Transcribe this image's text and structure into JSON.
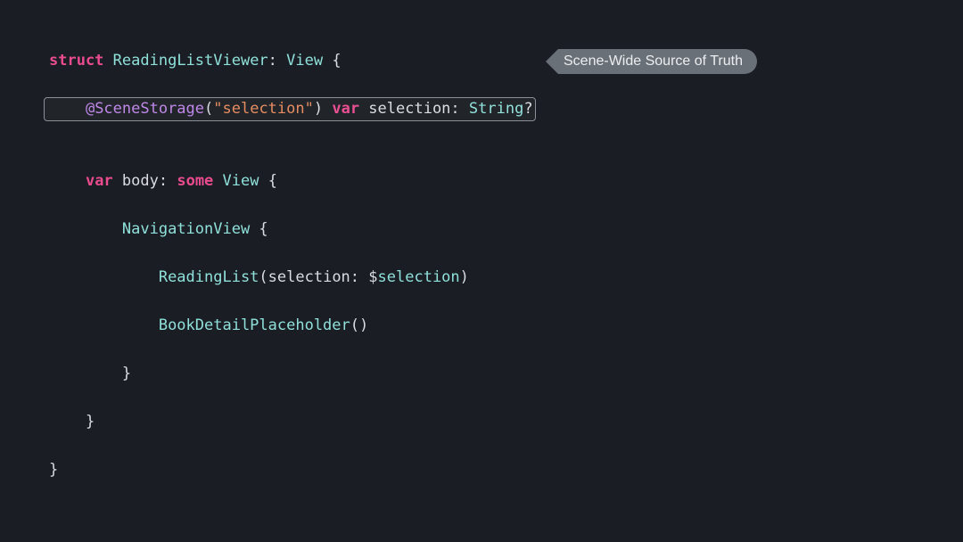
{
  "code": {
    "l1": {
      "kw_struct": "struct",
      "name": "ReadingListViewer",
      "colon": ":",
      "proto": "View",
      "brace": " {"
    },
    "l2": {
      "indent": "    ",
      "attr": "@SceneStorage",
      "lp": "(",
      "str": "\"selection\"",
      "rp": ")",
      "kw_var": " var",
      "varname": " selection",
      "colon": ":",
      "type": " String",
      "q": "?"
    },
    "blank": "",
    "l4": {
      "indent": "    ",
      "kw_var": "var",
      "name": " body",
      "colon": ":",
      "kw_some": " some",
      "type": " View",
      "brace": " {"
    },
    "l5": {
      "indent": "        ",
      "name": "NavigationView",
      "brace": " {"
    },
    "l6": {
      "indent": "            ",
      "name": "ReadingList",
      "args_open": "(",
      "arglabel": "selection",
      "colon": ":",
      "dollar": " $",
      "argref": "selection",
      "args_close": ")"
    },
    "l7": {
      "indent": "            ",
      "name": "BookDetailPlaceholder",
      "parens": "()"
    },
    "l8": {
      "indent": "        ",
      "brace": "}"
    },
    "l9": {
      "indent": "    ",
      "brace": "}"
    },
    "l10": {
      "brace": "}"
    }
  },
  "callout": {
    "label": "Scene-Wide Source of Truth"
  }
}
